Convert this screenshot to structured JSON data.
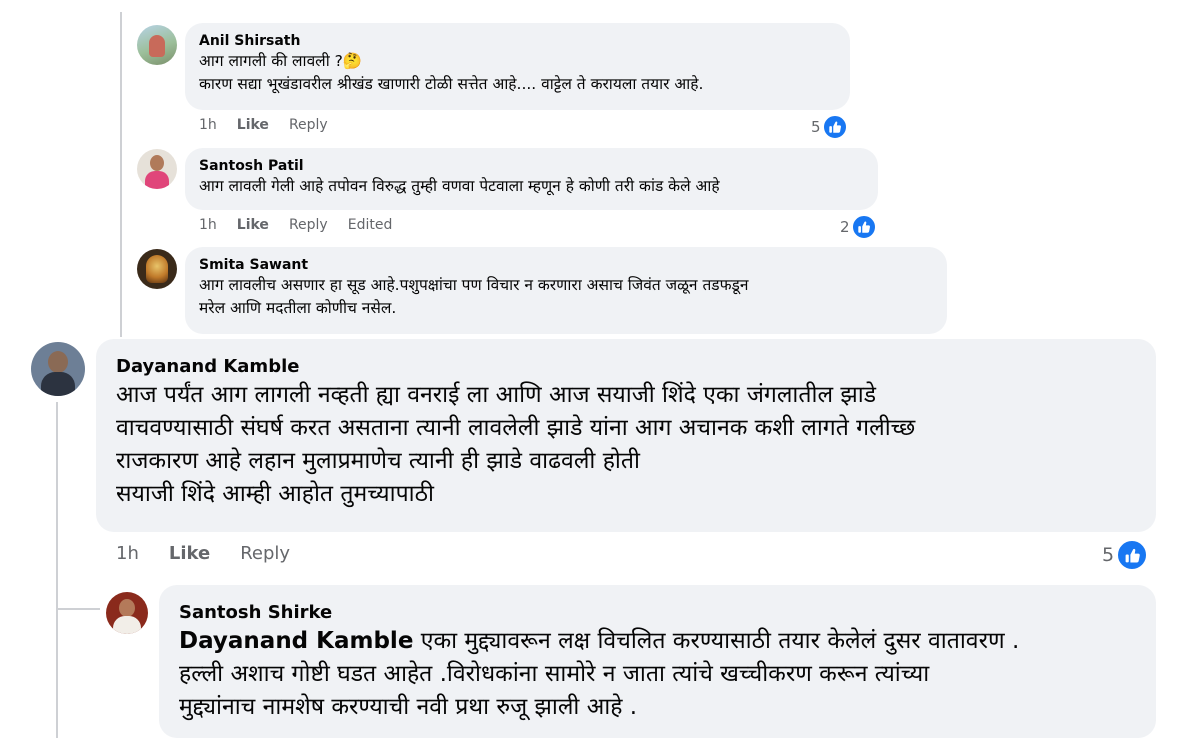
{
  "comments": [
    {
      "author": "Anil Shirsath",
      "lines": [
        "आग लागली की लावली ?🤔",
        "कारण सद्या भूखंडावरील श्रीखंड खाणारी टोळी सत्तेत आहे.... वाट्टेल ते करायला तयार आहे."
      ],
      "time": "1h",
      "like": "Like",
      "reply": "Reply",
      "reactions": "5"
    },
    {
      "author": "Santosh Patil",
      "lines": [
        "आग लावली गेली आहे तपोवन विरुद्ध तुम्ही वणवा पेटवाला म्हणून हे कोणी तरी कांड केले आहे"
      ],
      "time": "1h",
      "like": "Like",
      "reply": "Reply",
      "edited": "Edited",
      "reactions": "2"
    },
    {
      "author": "Smita Sawant",
      "lines": [
        "आग लावलीच असणार हा सूड आहे.पशुपक्षांचा पण विचार न करणारा असाच जिवंत जळून तडफडून",
        "मरेल आणि मदतीला कोणीच नसेल."
      ]
    },
    {
      "author": "Dayanand Kamble",
      "lines": [
        "आज पर्यंत आग लागली नव्हती ह्या वनराई ला आणि आज सयाजी शिंदे एका जंगलातील झाडे",
        "वाचवण्यासाठी संघर्ष करत असताना त्यानी लावलेली झाडे यांना आग अचानक कशी लागते गलीच्छ",
        "राजकारण आहे लहान मुलाप्रमाणेच त्यानी ही झाडे वाढवली होती",
        "सयाजी शिंदे आम्ही आहोत तुमच्यापाठी"
      ],
      "time": "1h",
      "like": "Like",
      "reply": "Reply",
      "reactions": "5"
    },
    {
      "author": "Santosh Shirke",
      "mention": "Dayanand Kamble",
      "lines": [
        "एका मुद्द्यावरून लक्ष विचलित करण्यासाठी तयार केलेलं दुसर वातावरण .",
        "हल्ली अशाच गोष्टी घडत आहेत .विरोधकांना सामोरे न जाता त्यांचे खच्चीकरण करून त्यांच्या",
        "मुद्द्यांनाच नामशेष करण्याची नवी प्रथा रुजू झाली आहे ."
      ]
    }
  ],
  "colors": {
    "bubble": "#f0f2f5",
    "meta_text": "#65676b",
    "like_blue": "#1877f2",
    "thread": "#ced0d4"
  }
}
